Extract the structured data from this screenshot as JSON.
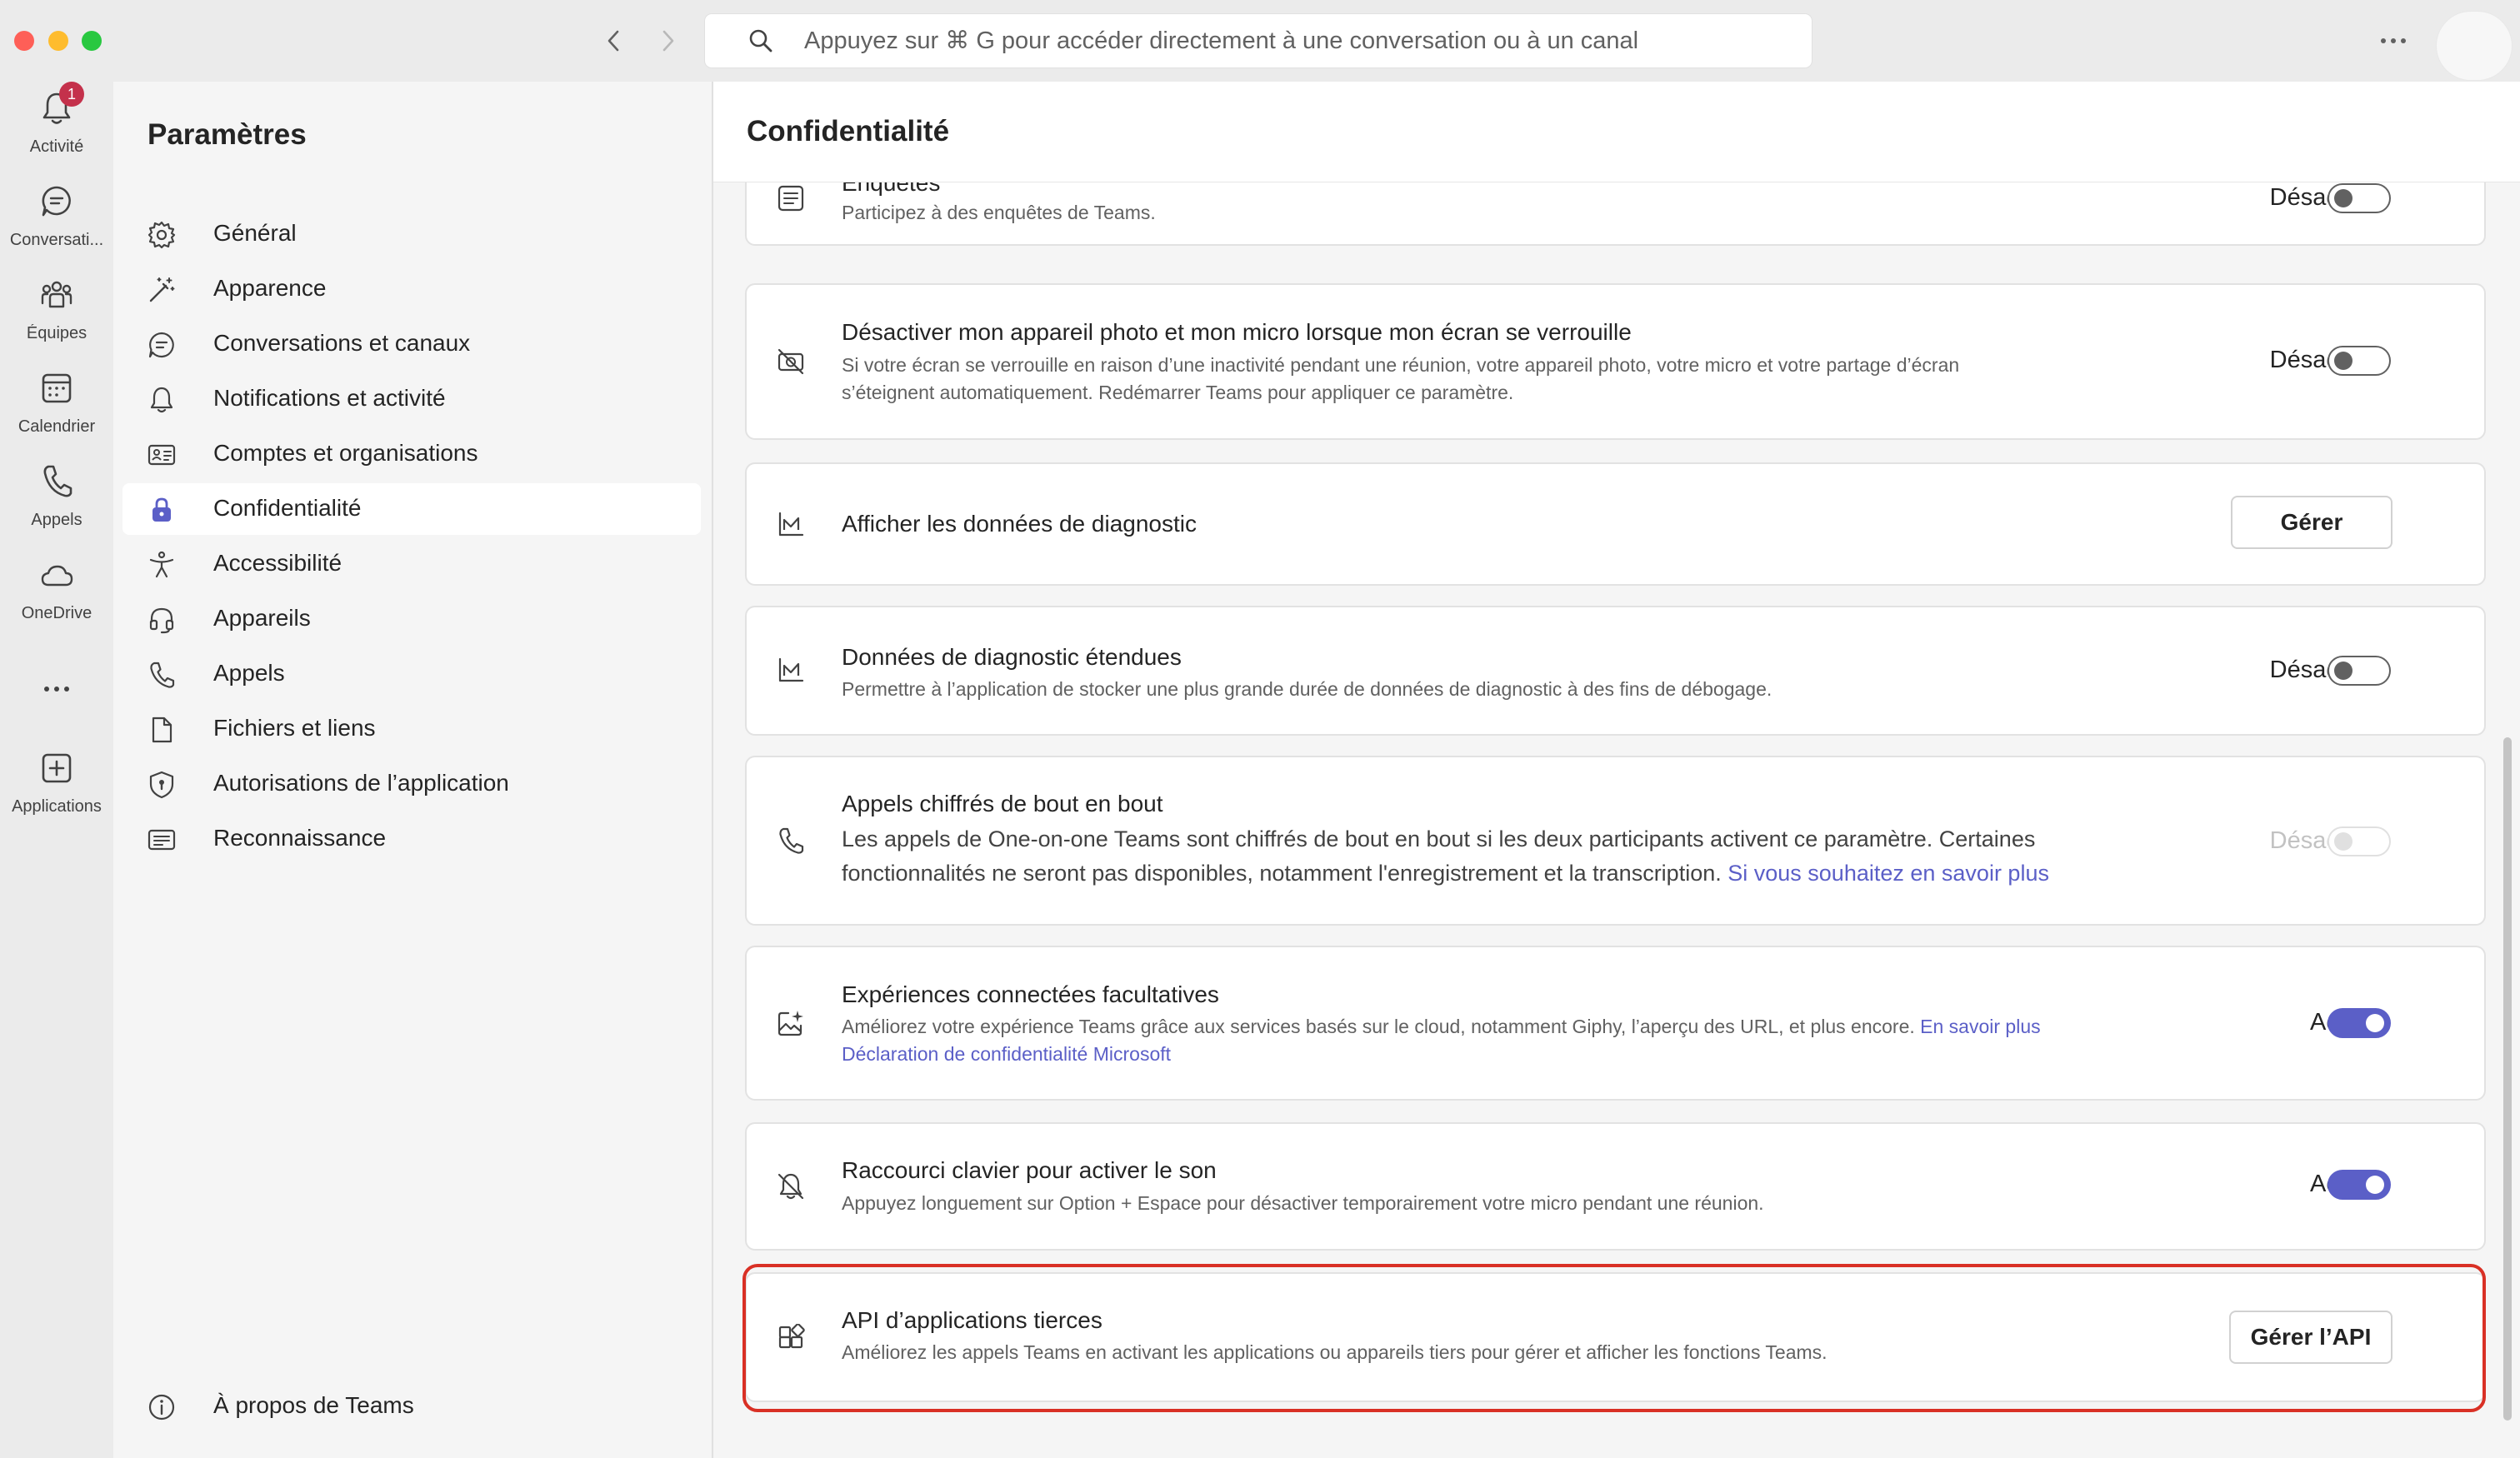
{
  "titlebar": {
    "search_placeholder": "Appuyez sur ⌘ G pour accéder directement à une conversation ou à un canal",
    "back_icon": "chevron-left-icon",
    "forward_icon": "chevron-right-icon",
    "more_icon": "more-horizontal-icon"
  },
  "rail": {
    "items": [
      {
        "label": "Activité",
        "icon": "bell-icon",
        "badge": "1"
      },
      {
        "label": "Conversati...",
        "icon": "chat-icon"
      },
      {
        "label": "Équipes",
        "icon": "teams-icon"
      },
      {
        "label": "Calendrier",
        "icon": "calendar-icon"
      },
      {
        "label": "Appels",
        "icon": "phone-icon"
      },
      {
        "label": "OneDrive",
        "icon": "cloud-icon"
      },
      {
        "label": "Applications",
        "icon": "add-app-icon"
      }
    ]
  },
  "settings": {
    "title": "Paramètres",
    "items": [
      {
        "label": "Général",
        "icon": "gear-icon"
      },
      {
        "label": "Apparence",
        "icon": "magic-wand-icon"
      },
      {
        "label": "Conversations et canaux",
        "icon": "chat-icon"
      },
      {
        "label": "Notifications et activité",
        "icon": "bell-icon"
      },
      {
        "label": "Comptes et organisations",
        "icon": "id-card-icon"
      },
      {
        "label": "Confidentialité",
        "icon": "lock-icon",
        "selected": true
      },
      {
        "label": "Accessibilité",
        "icon": "accessibility-icon"
      },
      {
        "label": "Appareils",
        "icon": "headset-icon"
      },
      {
        "label": "Appels",
        "icon": "phone-icon"
      },
      {
        "label": "Fichiers et liens",
        "icon": "document-icon"
      },
      {
        "label": "Autorisations de l’application",
        "icon": "shield-icon"
      },
      {
        "label": "Reconnaissance",
        "icon": "caption-icon"
      }
    ],
    "about": {
      "label": "À propos de Teams",
      "icon": "info-icon"
    }
  },
  "main": {
    "title": "Confidentialité",
    "cards": [
      {
        "title": "Enquêtes",
        "desc": "Participez à des enquêtes de Teams.",
        "state": "Désactivé",
        "toggle": "off",
        "icon": "survey-icon"
      },
      {
        "title": "Désactiver mon appareil photo et mon micro lorsque mon écran se verrouille",
        "desc1": "Si votre écran se verrouille en raison d’une inactivité pendant une réunion, votre appareil photo, votre micro et votre partage d’écran",
        "desc2": "s’éteignent automatiquement. Redémarrer Teams pour appliquer ce paramètre.",
        "state": "Désactivé",
        "toggle": "off",
        "icon": "camera-off-icon"
      },
      {
        "title": "Afficher les données de diagnostic",
        "button": "Gérer",
        "icon": "chart-icon"
      },
      {
        "title": "Données de diagnostic étendues",
        "desc": "Permettre à l’application de stocker une plus grande durée de données de diagnostic à des fins de débogage.",
        "state": "Désactivé",
        "toggle": "off",
        "icon": "chart-icon"
      },
      {
        "title": "Appels chiffrés de bout en bout",
        "desc1": "Les appels de One-on-one Teams sont chiffrés de bout en bout si les deux participants activent ce paramètre. Certaines",
        "desc2": "fonctionnalités ne seront pas disponibles, notamment l'enregistrement et la transcription.",
        "link": "Si vous souhaitez en savoir plus",
        "state": "Désactivé",
        "toggle": "disabled",
        "icon": "phone-icon"
      },
      {
        "title": "Expériences connectées facultatives",
        "desc1": "Améliorez votre expérience Teams grâce aux services basés sur le cloud, notamment Giphy, l’aperçu des URL, et plus encore.",
        "link1": "En savoir plus",
        "link2": "Déclaration de confidentialité Microsoft",
        "state": "Activé",
        "toggle": "on",
        "icon": "image-sparkle-icon"
      },
      {
        "title": "Raccourci clavier pour activer le son",
        "desc": "Appuyez longuement sur Option + Espace pour désactiver temporairement votre micro pendant une réunion.",
        "state": "Activé",
        "toggle": "on",
        "icon": "bell-off-icon"
      },
      {
        "title": "API d’applications tierces",
        "desc": "Améliorez les appels Teams en activant les applications ou appareils tiers pour gérer et afficher les fonctions Teams.",
        "button": "Gérer l’API",
        "icon": "apps-icon"
      }
    ]
  },
  "colors": {
    "accent": "#5b5fc7",
    "highlight": "#d93025",
    "badge": "#c4314b"
  }
}
